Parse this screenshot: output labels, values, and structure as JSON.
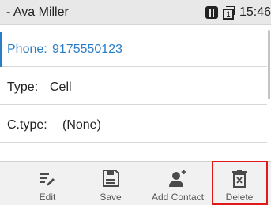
{
  "header": {
    "title": "- Ava Miller",
    "time": "15:46",
    "icons": [
      "sim-card-icon",
      "copy-sim-icon"
    ],
    "sim_index": "1"
  },
  "form": {
    "phone": {
      "label": "Phone:",
      "value": "9175550123"
    },
    "type": {
      "label": "Type:",
      "value": "Cell"
    },
    "ctype": {
      "label": "C.type:",
      "value": "(None)"
    }
  },
  "toolbar": {
    "edit_label": "Edit",
    "save_label": "Save",
    "add_contact_label": "Add Contact",
    "delete_label": "Delete",
    "highlighted": "Delete"
  },
  "colors": {
    "accent": "#2a7ec7",
    "highlight": "#e0191b",
    "titlebar_bg": "#e8e8e8",
    "toolbar_bg": "#f1f1f1"
  }
}
